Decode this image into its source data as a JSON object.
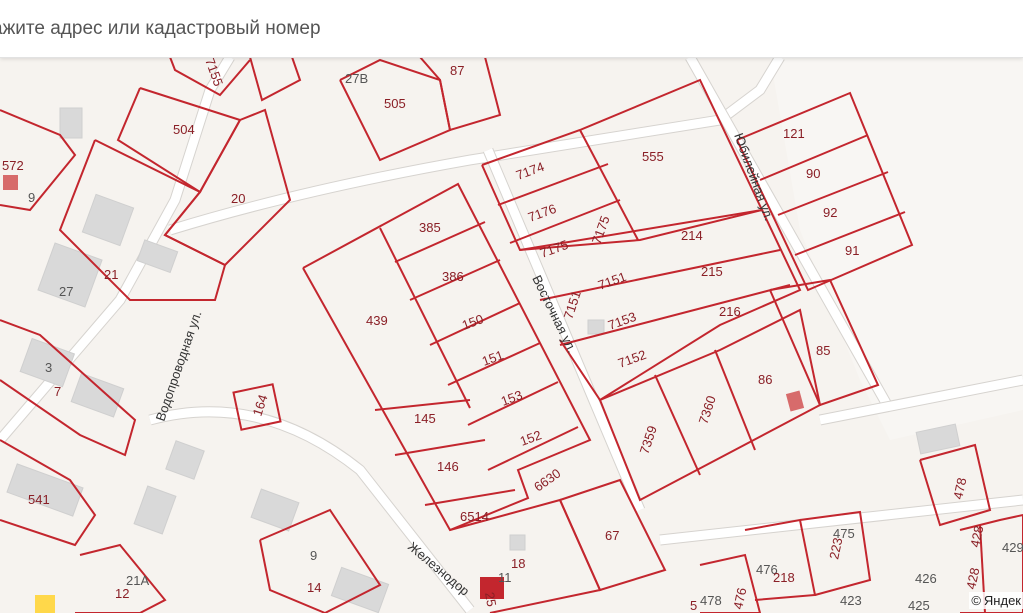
{
  "search": {
    "placeholder": "ажите адрес или кадастровый номер"
  },
  "streets": {
    "vodoprovodnaya": "Водопроводная ул.",
    "vostochnaya": "Восточная ул.",
    "yubileynaya": "Юбилейная ул.",
    "zheleznodorozhnaya": "Железнодор"
  },
  "plots": {
    "p572": "572",
    "p504": "504",
    "p20": "20",
    "p21": "21",
    "p27": "27",
    "p3": "3",
    "p7": "7",
    "p541": "541",
    "p7155": "7155",
    "p27v": "27В",
    "p505": "505",
    "p87": "87",
    "p7174": "7174",
    "p7176": "7176",
    "p7175a": "7175",
    "p7175b": "7175",
    "p555": "555",
    "p121": "121",
    "p90": "90",
    "p92": "92",
    "p91": "91",
    "p385": "385",
    "p386": "386",
    "p439": "439",
    "p150": "150",
    "p151": "151",
    "p153": "153",
    "p145": "145",
    "p146": "146",
    "p152": "152",
    "p6630": "6630",
    "p6514": "6514",
    "p7151a": "7151",
    "p7151b": "7151",
    "p214": "214",
    "p215": "215",
    "p216": "216",
    "p7153": "7153",
    "p7152": "7152",
    "p85": "85",
    "p86": "86",
    "p7359": "7359",
    "p7360": "7360",
    "p164": "164",
    "p67": "67",
    "p18": "18",
    "p11": "11",
    "p25": "25",
    "p9a": "9",
    "p9": "9",
    "p14": "14",
    "p21a": "21А",
    "p12": "12",
    "p478a": "478",
    "p478b": "478",
    "p476a": "476",
    "p476b": "476",
    "p218": "218",
    "p223": "223",
    "p475": "475",
    "p426": "426",
    "p423": "423",
    "p428a": "428",
    "p428b": "428",
    "p429": "429",
    "p425": "425",
    "p5": "5"
  },
  "copyright": {
    "text": "Яндек"
  },
  "colors": {
    "boundary": "#c3262e",
    "label": "#8a1f26",
    "map_bg": "#f6f3ef",
    "water": "#bfe1f7"
  }
}
